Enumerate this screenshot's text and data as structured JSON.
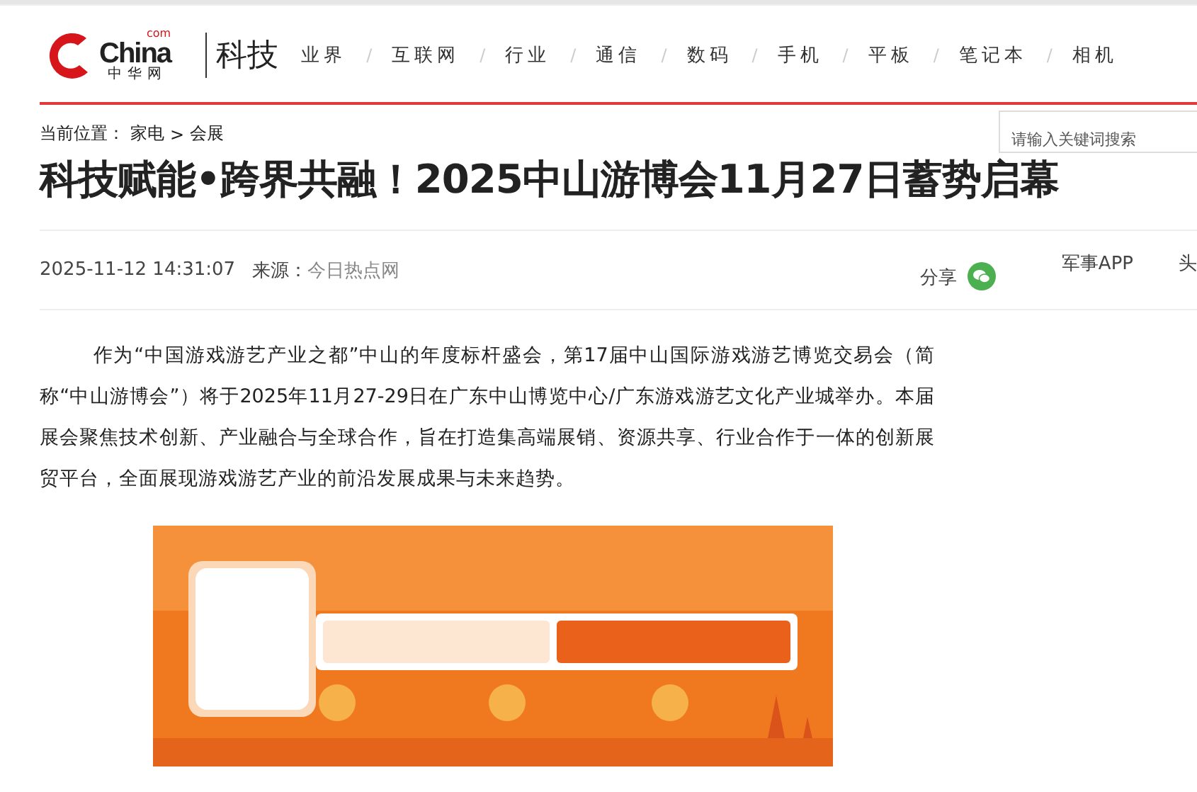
{
  "header": {
    "logo": {
      "brand": "China",
      "domain": "com",
      "chinese": "中华网"
    },
    "channel": "科技",
    "nav_separator": "/",
    "nav": [
      {
        "label": "业界"
      },
      {
        "label": "互联网"
      },
      {
        "label": "行业"
      },
      {
        "label": "通信"
      },
      {
        "label": "数码"
      },
      {
        "label": "手机"
      },
      {
        "label": "平板"
      },
      {
        "label": "笔记本"
      },
      {
        "label": "相机"
      }
    ]
  },
  "breadcrumb": {
    "prefix": "当前位置：",
    "items": [
      "家电",
      "会展"
    ],
    "separator": ">"
  },
  "search": {
    "placeholder": "请输入关键词搜索"
  },
  "article": {
    "title": "科技赋能•跨界共融！2025中山游博会11月27日蓄势启幕",
    "date": "2025-11-12 14:31:07",
    "source_label": "来源：",
    "source": "今日热点网",
    "share": "分享",
    "links": [
      "军事APP",
      "头"
    ],
    "paragraph": "作为“中国游戏游艺产业之都”中山的年度标杆盛会，第17届中山国际游戏游艺博览交易会（简称“中山游博会”）将于2025年11月27-29日在广东中山博览中心/广东游戏游艺文化产业城举办。本届展会聚焦技术创新、产业融合与全球合作，旨在打造集高端展销、资源共享、行业合作于一体的创新展贸平台，全面展现游戏游艺产业的前沿发展成果与未来趋势。"
  }
}
